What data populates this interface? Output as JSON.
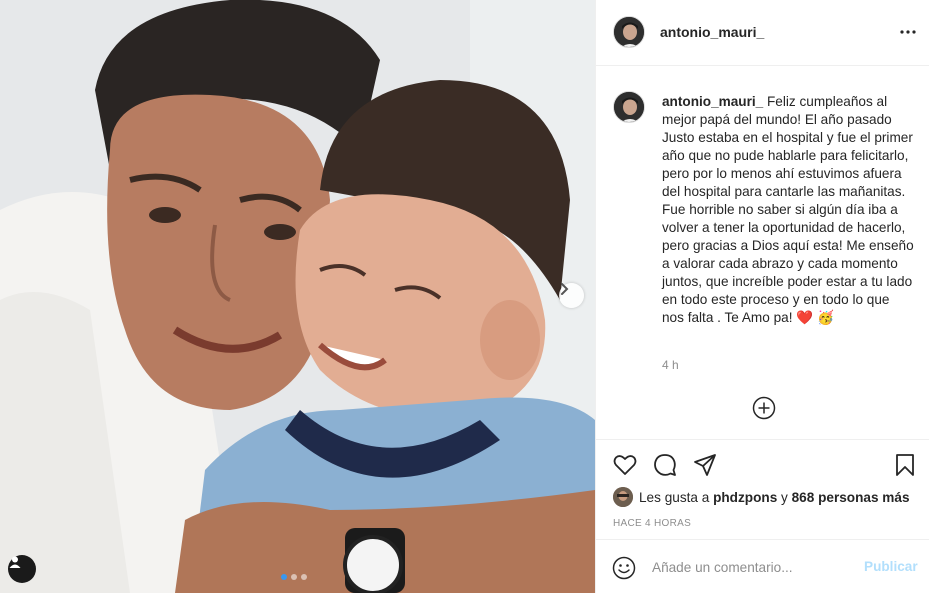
{
  "post": {
    "username": "antonio_mauri_",
    "caption": "Feliz cumpleaños al mejor papá del mundo! El año pasado Justo estaba en el hospital y fue el primer año que no pude hablarle para felicitarlo, pero por lo menos ahí estuvimos afuera del hospital para cantarle las mañanitas. Fue horrible no saber si algún día iba a volver a tener la oportunidad de hacerlo, pero gracias a Dios aquí esta! Me enseño a valorar cada abrazo y cada momento juntos, que increíble poder estar a tu lado en todo este proceso y en todo lo que nos falta . Te Amo pa!",
    "caption_emoji": "❤️ 🥳",
    "timestamp": "4 h",
    "likes_prefix": "Les gusta a",
    "likes_user": "phdzpons",
    "likes_connector": "y",
    "likes_count": "868 personas más",
    "time_ago": "HACE 4 HORAS"
  },
  "comment": {
    "placeholder": "Añade un comentario...",
    "publish_label": "Publicar"
  },
  "carousel": {
    "total_slides": 3,
    "active_slide": 1
  },
  "icons": {
    "more": "more-options-icon",
    "like": "heart-icon",
    "comment": "comment-icon",
    "share": "share-icon",
    "save": "bookmark-icon",
    "load_more": "plus-circle-icon",
    "emoji": "emoji-icon",
    "next": "chevron-right-icon",
    "tag": "user-tag-icon"
  },
  "colors": {
    "publish_disabled": "#b2dffc",
    "carousel_active_dot": "#3897f0",
    "heart_emoji": "#e0245e"
  }
}
